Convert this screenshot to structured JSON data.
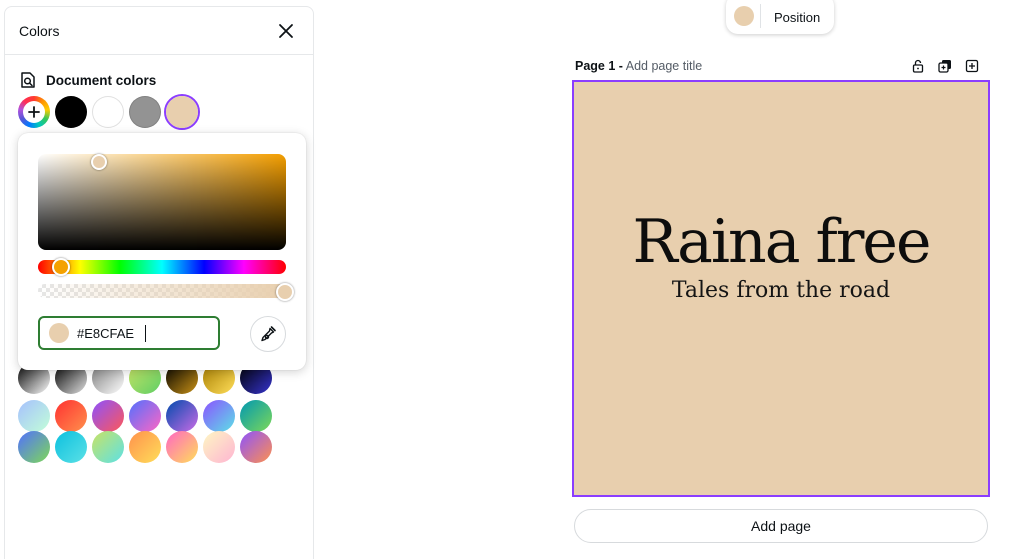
{
  "panel": {
    "title": "Colors",
    "document_colors_label": "Document colors",
    "document_colors": [
      "#000000",
      "#ffffff",
      "#939393",
      "#e8cfae"
    ],
    "selected_color": "#e8cfae"
  },
  "picker": {
    "hex_value": "#E8CFAE",
    "hue_color": "#f39e00",
    "hue_fraction": 0.1,
    "alpha_fraction": 1.0
  },
  "gradients": [
    [
      [
        "#000000",
        "#ffffff"
      ],
      [
        "#000000",
        "#e0e0e0"
      ],
      [
        "#7a7a7a",
        "#ffffff"
      ],
      [
        "#c9e265",
        "#5fcf65"
      ],
      [
        "#000000",
        "#c89116"
      ],
      [
        "#a67c00",
        "#ffde59"
      ],
      [
        "#000000",
        "#3533cd"
      ]
    ],
    [
      [
        "#a6c0fe",
        "#c2ffd8"
      ],
      [
        "#ff3131",
        "#ff914d"
      ],
      [
        "#8c52ff",
        "#ff5757"
      ],
      [
        "#5170ff",
        "#ff66c4"
      ],
      [
        "#004aad",
        "#cb6ce6"
      ],
      [
        "#8c52ff",
        "#5ce1e6"
      ],
      [
        "#0097b2",
        "#7ed957"
      ]
    ],
    [
      [
        "#5170ff",
        "#7ed957"
      ],
      [
        "#0cc0df",
        "#5ce1e6"
      ],
      [
        "#c9e265",
        "#5ce1e6"
      ],
      [
        "#ff914d",
        "#ffde59"
      ],
      [
        "#ff66c4",
        "#ffde59"
      ],
      [
        "#fdf7c3",
        "#ffb4d2"
      ],
      [
        "#8c52ff",
        "#ff914d"
      ]
    ]
  ],
  "toolbar": {
    "position_label": "Position",
    "position_color": "#e8cfae"
  },
  "page": {
    "number_label": "Page 1 -",
    "title_placeholder": "Add page title",
    "background": "#e8cfae",
    "heading": "Raina free",
    "subheading": "Tales from the road",
    "add_page_label": "Add page"
  },
  "colors": {
    "accent": "#8b3dff",
    "input_focus": "#2e7d32"
  },
  "icons": [
    "close-icon",
    "document-search-icon",
    "plus-icon",
    "eyedropper-icon",
    "lock-icon",
    "duplicate-page-icon",
    "add-page-icon"
  ]
}
